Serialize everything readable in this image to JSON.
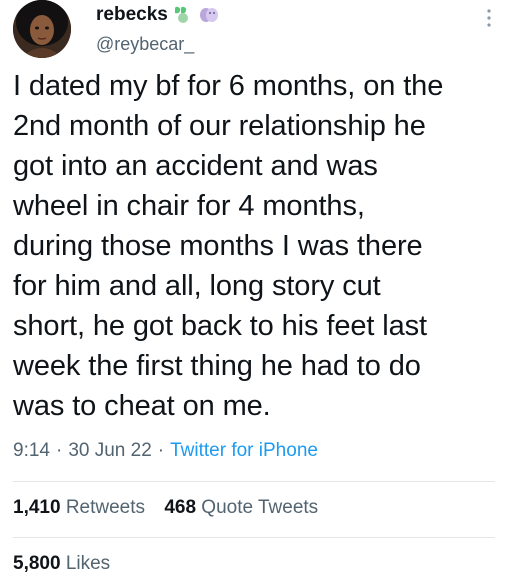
{
  "author": {
    "display_name": "rebecks",
    "handle": "@reybecar_",
    "name_emojis": [
      "green-heart-face-emoji",
      "theater-masks-emoji"
    ]
  },
  "tweet": {
    "text": "I dated my bf for 6 months, on the\n2nd month of our relationship he\ngot into an accident and was\nwheel in chair for 4 months,\nduring those months I was there\nfor him and all, long story cut\nshort, he got back to his feet last\nweek the first thing he had to do\nwas to cheat on me.",
    "time": "9:14",
    "date": "30 Jun 22",
    "source": "Twitter for iPhone"
  },
  "stats": {
    "retweets_count": "1,410",
    "retweets_label": "Retweets",
    "quotes_count": "468",
    "quotes_label": "Quote Tweets",
    "likes_count": "5,800",
    "likes_label": "Likes"
  },
  "icons": {
    "more": "more-vertical-icon"
  },
  "colors": {
    "link": "#1d9bf0",
    "secondary_text": "#536471",
    "primary_text": "#0f1419"
  }
}
